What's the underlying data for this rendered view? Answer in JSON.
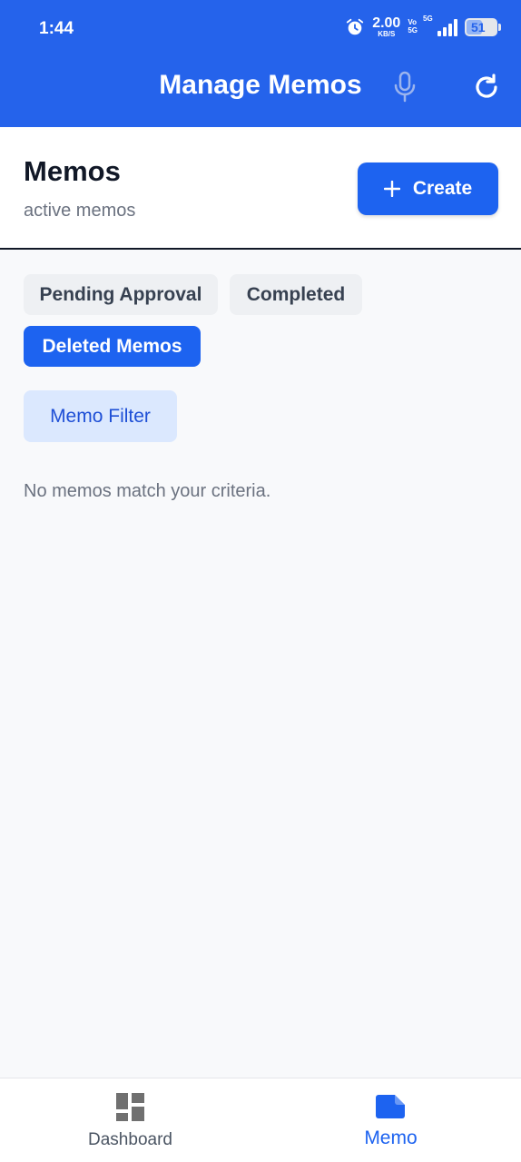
{
  "status_bar": {
    "time": "1:44",
    "net_speed_value": "2.00",
    "net_speed_unit": "KB/S",
    "volte_top": "Vo",
    "volte_bottom": "5G",
    "signal_tag": "5G",
    "battery": "51"
  },
  "app_bar": {
    "title": "Manage Memos",
    "icons": [
      "mic-icon",
      "refresh-icon"
    ],
    "color": "#2563eb"
  },
  "header": {
    "title": "Memos",
    "subtitle": "active memos",
    "create_label": "Create"
  },
  "tabs": [
    {
      "label": "Pending Approval",
      "active": false
    },
    {
      "label": "Completed",
      "active": false
    },
    {
      "label": "Deleted Memos",
      "active": true
    }
  ],
  "filter": {
    "label": "Memo Filter"
  },
  "empty_state": "No memos match your criteria.",
  "bottom_nav": {
    "items": [
      {
        "label": "Dashboard",
        "icon": "dashboard-icon",
        "active": false
      },
      {
        "label": "Memo",
        "icon": "memo-icon",
        "active": true
      }
    ]
  },
  "colors": {
    "accent": "#1d63f0",
    "chip_inactive": "#eef0f3",
    "filter_bg": "#dbe8fe"
  }
}
